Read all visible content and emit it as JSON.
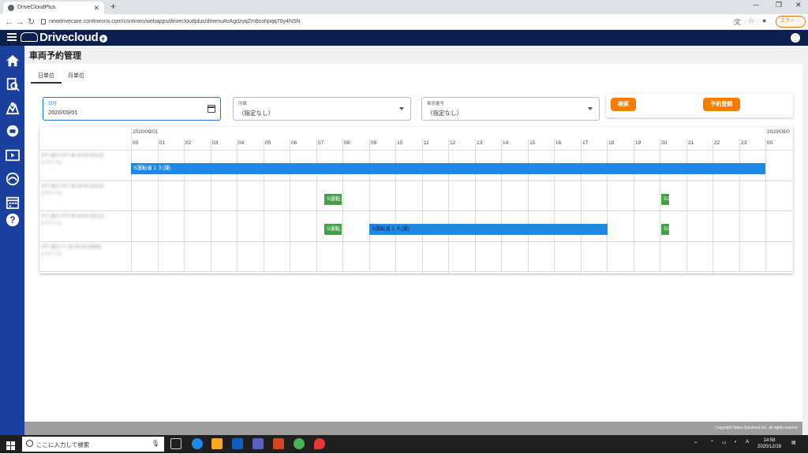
{
  "browser": {
    "tab_title": "DriveCloudPlus",
    "url": "newdrivecare.contineonx.com/contineo/webapps/drivecloudplus/dmenu#cAgdzyqZm8cohpqq70y4NSN",
    "error_label": "エラー"
  },
  "app": {
    "brand": "Drivecloud"
  },
  "page": {
    "title": "車両予約管理",
    "tabs": [
      "日単位",
      "月単位"
    ]
  },
  "filters": {
    "date": {
      "label": "日付",
      "value": "2020/09/01"
    },
    "office": {
      "label": "所属",
      "value": "（指定なし）"
    },
    "vehicle": {
      "label": "車両番号",
      "value": "（指定なし）"
    },
    "search_button": "検索",
    "register_button": "予約登録"
  },
  "schedule": {
    "date_start": "2020/09/01",
    "date_end": "2020/09/0",
    "hours": [
      "00",
      "01",
      "02",
      "03",
      "04",
      "05",
      "06",
      "07",
      "08",
      "09",
      "10",
      "11",
      "12",
      "13",
      "14",
      "15",
      "16",
      "17",
      "18",
      "19",
      "20",
      "21",
      "22",
      "23",
      "00"
    ],
    "rows": [
      {
        "vehicle": "S?? 品川 3?? あ 00-00 (9113)",
        "sub": "(???? ??)",
        "bookings": [
          {
            "label": "S運転者１３(課)",
            "start": 0,
            "end": 24,
            "color": "blue"
          }
        ]
      },
      {
        "vehicle": "S?? 品川 3?? あ 00-00 (9113)",
        "sub": "(???? ??)",
        "bookings": [
          {
            "label": "S運転",
            "start": 7.3,
            "end": 7.95,
            "color": "green"
          },
          {
            "label": "S2",
            "start": 20.05,
            "end": 20.35,
            "color": "green"
          }
        ]
      },
      {
        "vehicle": "S?? 品川 3?? あ 00-00 (9113)",
        "sub": "(???? ??)",
        "bookings": [
          {
            "label": "S運転",
            "start": 7.3,
            "end": 7.95,
            "color": "green"
          },
          {
            "label": "S運転者１４(課)",
            "start": 9.0,
            "end": 18.0,
            "color": "blue"
          },
          {
            "label": "S2",
            "start": 20.05,
            "end": 20.35,
            "color": "green"
          }
        ]
      },
      {
        "vehicle": "S?? 品川 ?? あ 00-00 (9999)",
        "sub": "(???? ??)",
        "bookings": []
      }
    ]
  },
  "footer": {
    "copyright": "Copyright Seiko Solutions Inc. all rights reserve"
  },
  "taskbar": {
    "search_placeholder": "ここに入力して検索",
    "time": "14:58",
    "date": "2020/12/16"
  }
}
